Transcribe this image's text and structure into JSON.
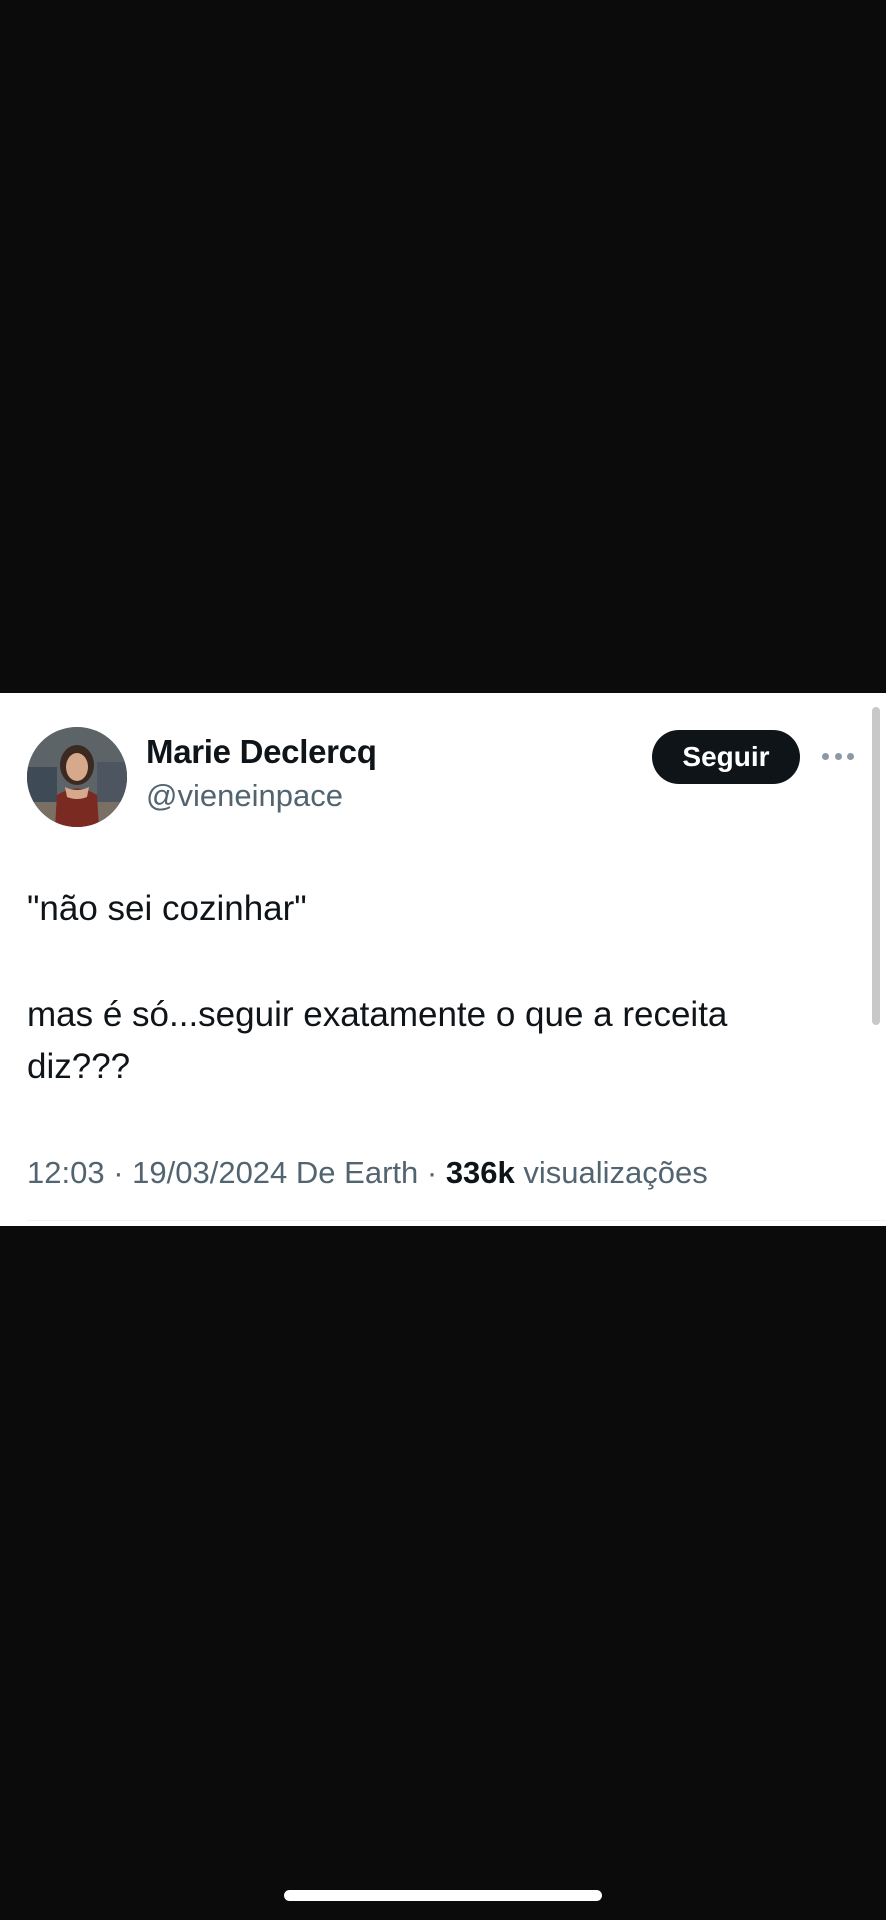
{
  "tweet": {
    "author": {
      "display_name": "Marie Declercq",
      "handle": "@vieneinpace",
      "avatar_icon": "profile-photo"
    },
    "follow_label": "Seguir",
    "more_icon": "more-horizontal-icon",
    "text": {
      "line1": "\"não sei cozinhar\"",
      "line2": "mas é só...seguir exatamente o que a receita diz???"
    },
    "meta": {
      "time": "12:03",
      "separator1": " · ",
      "date": "19/03/2024",
      "source": " De Earth",
      "separator2": " · ",
      "views_count": "336k",
      "views_label": " visualizações"
    }
  },
  "colors": {
    "background": "#0b0b0b",
    "card": "#ffffff",
    "text_primary": "#0f1419",
    "text_secondary": "#536471",
    "button_bg": "#0f1419"
  }
}
